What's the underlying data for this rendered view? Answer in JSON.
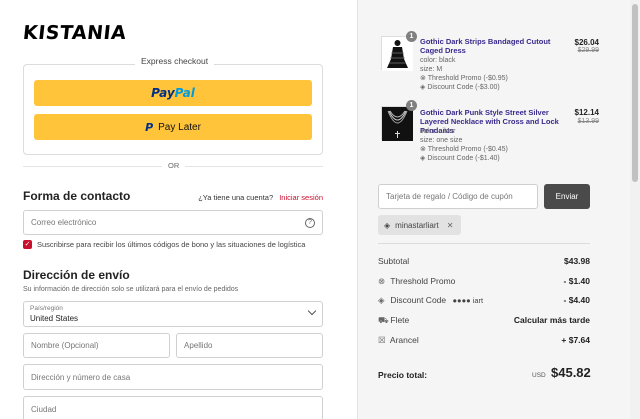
{
  "brand": {
    "logo_text": "KISTANIA"
  },
  "express": {
    "title": "Express checkout",
    "paypal_pay": "Pay",
    "paypal_pal": "Pal",
    "paylater_label": "Pay Later",
    "or_label": "OR",
    "button_color": "#ffc439"
  },
  "contact": {
    "heading": "Forma de contacto",
    "has_account": "¿Ya tiene una cuenta?",
    "login_link": "Iniciar sesión",
    "email_placeholder": "Correo electrónico",
    "subscribe_label": "Suscribirse para recibir los últimos códigos de bono y las situaciones de logística",
    "subscribe_checked": true
  },
  "shipping": {
    "heading": "Dirección de envío",
    "subheading": "Su información de dirección solo se utilizará para el envío de pedidos",
    "country_label": "País/región",
    "country_value": "United States",
    "first_name_placeholder": "Nombre (Opcional)",
    "last_name_placeholder": "Apellido",
    "address_placeholder": "Dirección y número de casa",
    "city_placeholder": "Ciudad"
  },
  "cart": {
    "items": [
      {
        "qty": "1",
        "name": "Gothic Dark Strips Bandaged Cutout Caged Dress",
        "color": "color: black",
        "size": "size: M",
        "promo": "Threshold Promo (-$0.95)",
        "discount": "Discount Code (-$3.00)",
        "price": "$26.04",
        "old_price": "$29.99"
      },
      {
        "qty": "1",
        "name": "Gothic Dark Punk Style Street Silver Layered Necklace with Cross and Lock Pendants",
        "color": "color: silver",
        "size": "size: one size",
        "promo": "Threshold Promo (-$0.45)",
        "discount": "Discount Code (-$1.40)",
        "price": "$12.14",
        "old_price": "$13.99"
      }
    ],
    "coupon_placeholder": "Tarjeta de regalo / Código de cupón",
    "apply_label": "Enviar",
    "applied_code": "minastarliart"
  },
  "summary": {
    "subtotal_label": "Subtotal",
    "subtotal_value": "$43.98",
    "threshold_label": "Threshold Promo",
    "threshold_value": "- $1.40",
    "discount_label": "Discount Code",
    "discount_code_masked": "●●●● iart",
    "discount_value": "- $4.40",
    "shipping_label": "Flete",
    "shipping_value": "Calcular más tarde",
    "tariff_label": "Arancel",
    "tariff_value": "+ $7.64",
    "total_label": "Precio total:",
    "currency": "USD",
    "total_value": "$45.82"
  }
}
